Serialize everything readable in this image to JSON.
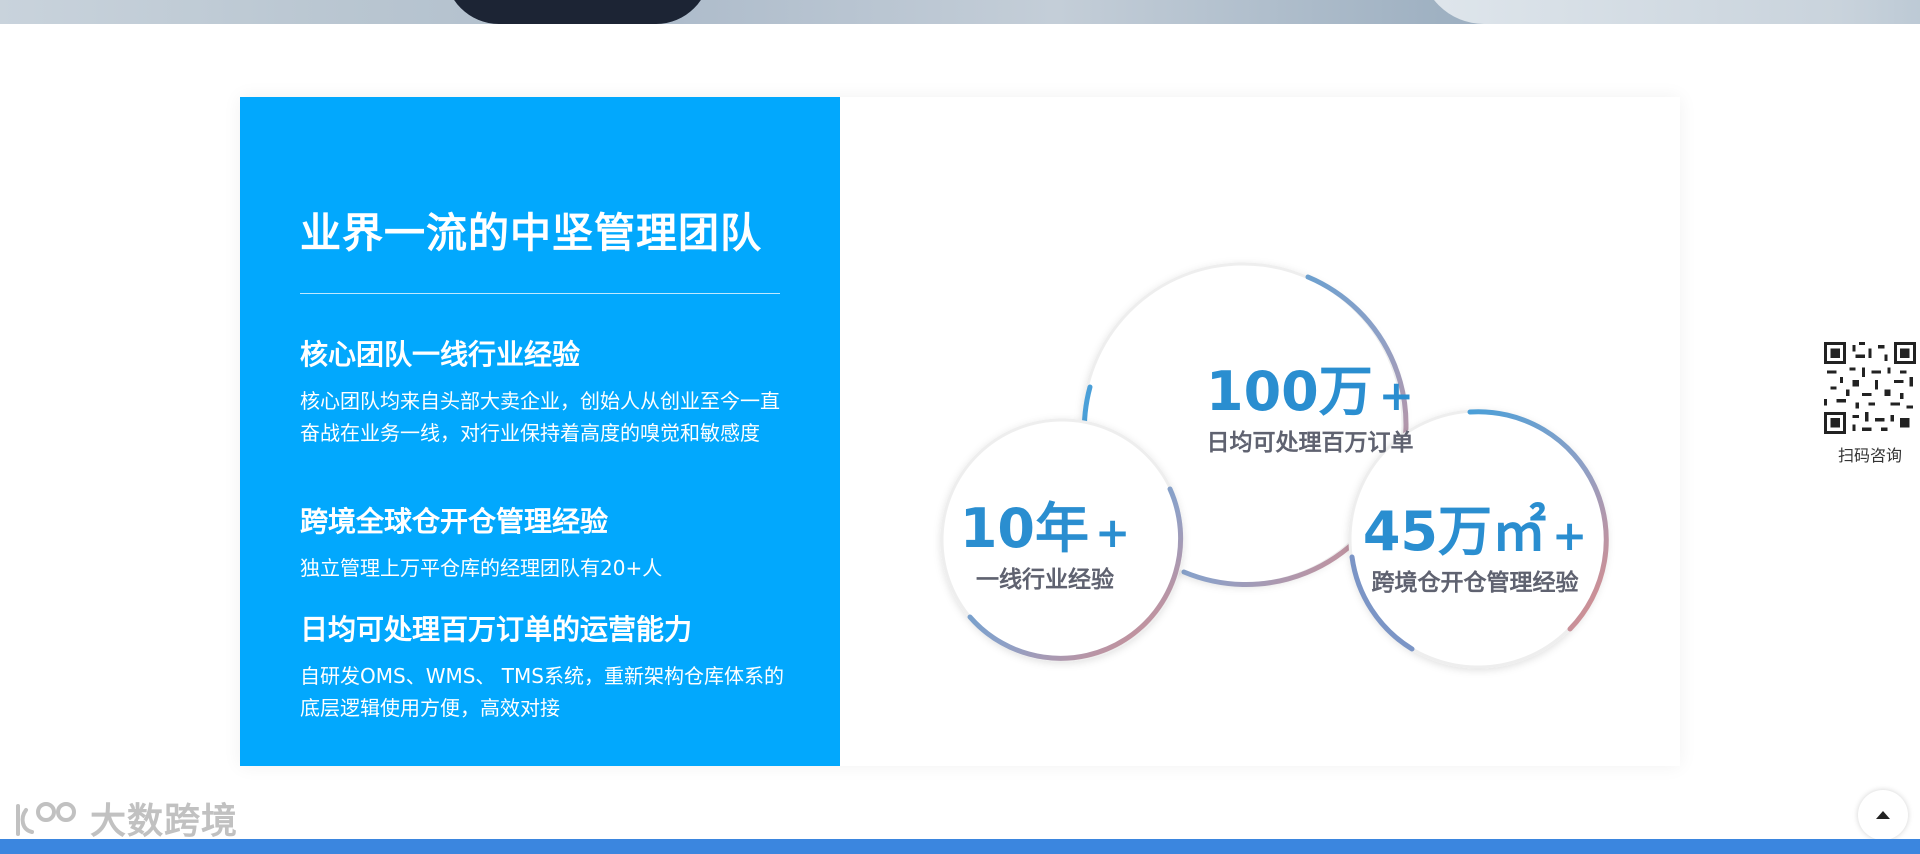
{
  "section": {
    "title": "业界一流的中坚管理团队",
    "features": [
      {
        "heading": "核心团队一线行业经验",
        "text": "核心团队均来自头部大卖企业，创始人从创业至今一直奋战在业务一线，对行业保持着高度的嗅觉和敏感度"
      },
      {
        "heading": "跨境全球仓开仓管理经验",
        "text": "独立管理上万平仓库的经理团队有20+人"
      },
      {
        "heading": "日均可处理百万订单的运营能力",
        "text": "自研发OMS、WMS、 TMS系统，重新架构仓库体系的底层逻辑使用方便，高效对接"
      }
    ]
  },
  "stats": [
    {
      "number": "100万",
      "suffix": "+",
      "label": "日均可处理百万订单"
    },
    {
      "number": "10年",
      "suffix": "+",
      "label": "一线行业经验"
    },
    {
      "number": "45万㎡",
      "suffix": "+",
      "label": "跨境仓开仓管理经验"
    }
  ],
  "qr": {
    "label": "扫码咨询"
  },
  "watermark": {
    "text": "大数跨境"
  },
  "colors": {
    "panel_blue": "#02a8fd",
    "number_blue": "#2a8ed0",
    "label_gray": "#5f6270",
    "ring_blue": "#4a9fd8",
    "ring_pink": "#e08a86",
    "bottom_bar": "#3b86df"
  },
  "icons": {
    "back_to_top": "caret-up-icon",
    "qr": "qr-code-icon",
    "logo": "dashu-logo-icon"
  }
}
